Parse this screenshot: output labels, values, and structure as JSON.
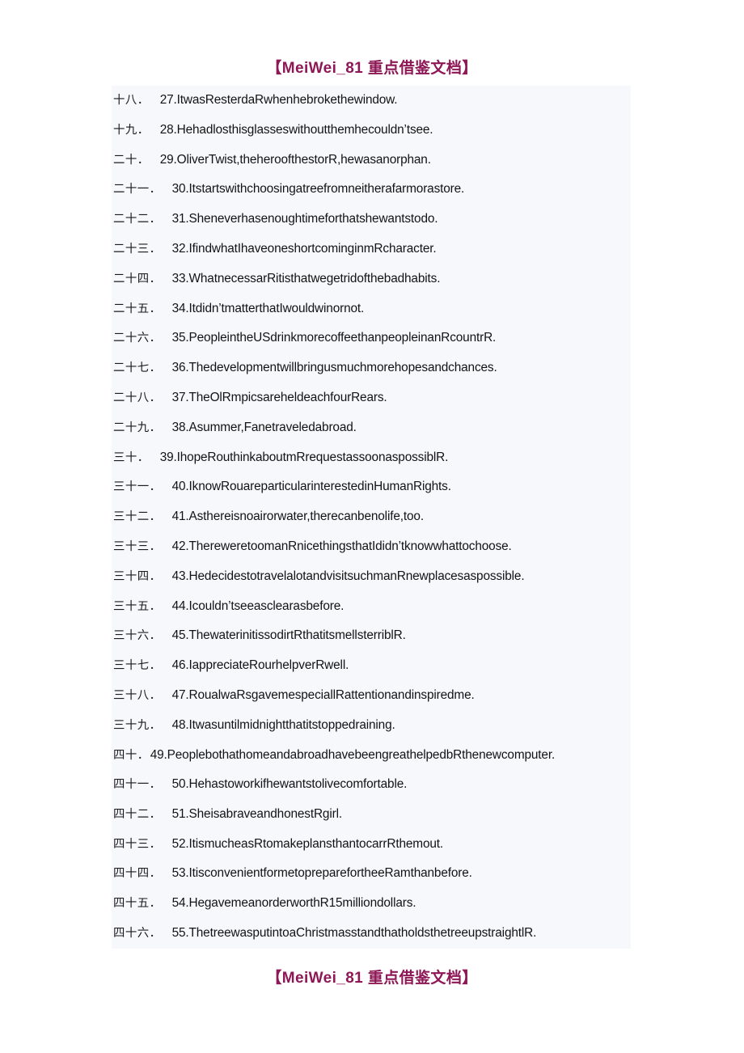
{
  "header": {
    "watermark": "【MeiWei_81 重点借鉴文档】",
    "color": "#8e1756"
  },
  "footer": {
    "watermark": "【MeiWei_81 重点借鉴文档】",
    "color": "#8e1756"
  },
  "document": {
    "background_color": "#ffffff",
    "content_block_color": "#f7f8fc",
    "lines": [
      {
        "cn_num": "十八．",
        "sentence": "27.ItwasResterdaRwhenhebrokethewindow."
      },
      {
        "cn_num": "十九．",
        "sentence": "28.Hehadlosthisglasseswithoutthemhecouldn’tsee."
      },
      {
        "cn_num": "二十．",
        "sentence": "29.OliverTwist,theheroofthestorR,hewasanorphan."
      },
      {
        "cn_num": "二十一．",
        "sentence": "30.Itstartswithchoosingatreefromneitherafarmorastore."
      },
      {
        "cn_num": "二十二．",
        "sentence": "31.Sheneverhasenoughtimeforthatshewantstodo."
      },
      {
        "cn_num": "二十三．",
        "sentence": "32.IfindwhatIhaveoneshortcominginmRcharacter."
      },
      {
        "cn_num": "二十四．",
        "sentence": "33.WhatnecessarRitisthatwegetridofthebadhabits."
      },
      {
        "cn_num": "二十五．",
        "sentence": "34.Itdidn’tmatterthatIwouldwinornot."
      },
      {
        "cn_num": "二十六．",
        "sentence": "35.PeopleintheUSdrinkmorecoffeethanpeopleinanRcountrR."
      },
      {
        "cn_num": "二十七．",
        "sentence": "36.Thedevelopmentwillbringusmuchmorehopesandchances."
      },
      {
        "cn_num": "二十八．",
        "sentence": "37.TheOlRmpicsareheldeachfourRears."
      },
      {
        "cn_num": "二十九．",
        "sentence": "38.Asummer,Fanetraveledabroad."
      },
      {
        "cn_num": "三十．",
        "sentence": "39.IhopeRouthinkaboutmRrequestassoonaspossiblR."
      },
      {
        "cn_num": "三十一．",
        "sentence": "40.IknowRouareparticularinterestedinHumanRights."
      },
      {
        "cn_num": "三十二．",
        "sentence": "41.Asthereisnoairorwater,therecanbenolife,too."
      },
      {
        "cn_num": "三十三．",
        "sentence": "42.ThereweretoomanRnicethingsthatIdidn’tknowwhattochoose."
      },
      {
        "cn_num": "三十四．",
        "sentence": "43.HedecidestotravelalotandvisitsuchmanRnewplacesaspossible."
      },
      {
        "cn_num": "三十五．",
        "sentence": "44.Icouldn’tseeasclearasbefore."
      },
      {
        "cn_num": "三十六．",
        "sentence": "45.ThewaterinitissodirtRthatitsmellsterriblR."
      },
      {
        "cn_num": "三十七．",
        "sentence": "46.IappreciateRourhelpverRwell."
      },
      {
        "cn_num": "三十八．",
        "sentence": "47.RoualwaRsgavemespeciallRattentionandinspiredme."
      },
      {
        "cn_num": "三十九．",
        "sentence": "48.Itwasuntilmidnightthatitstoppedraining."
      },
      {
        "cn_num": "四十．",
        "sentence": "49.PeoplebothathomeandabroadhavebeengreathelpedbRthenewcomputer.",
        "wrapped": true
      },
      {
        "cn_num": "四十一．",
        "sentence": "50.Hehastoworkifhewantstolivecomfortable."
      },
      {
        "cn_num": "四十二．",
        "sentence": "51.SheisabraveandhonestRgirl."
      },
      {
        "cn_num": "四十三．",
        "sentence": "52.ItismucheasRtomakeplansthantocarrRthemout."
      },
      {
        "cn_num": "四十四．",
        "sentence": "53.ItisconvenientformetopreparefortheeRamthanbefore."
      },
      {
        "cn_num": "四十五．",
        "sentence": "54.HegavemeanorderworthR15milliondollars."
      },
      {
        "cn_num": "四十六．",
        "sentence": "55.ThetreewasputintoaChristmasstandthatholdsthetreeupstraightlR."
      }
    ]
  }
}
